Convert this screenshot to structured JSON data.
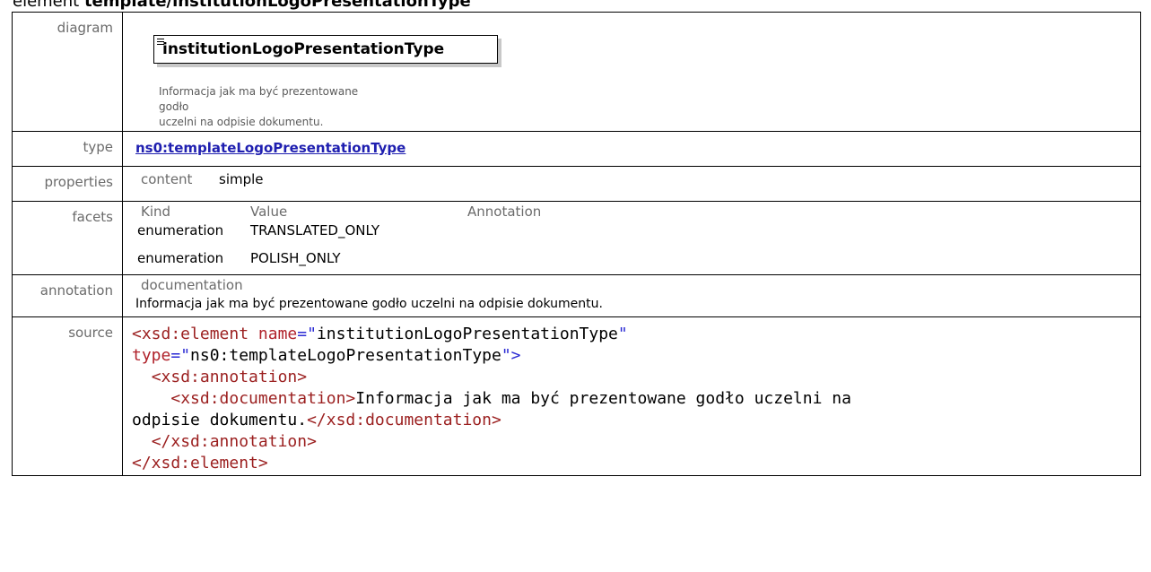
{
  "heading": {
    "prefix": "element ",
    "name": "template/institutionLogoPresentationType"
  },
  "labels": {
    "diagram": "diagram",
    "type": "type",
    "properties": "properties",
    "facets": "facets",
    "annotation": "annotation",
    "source": "source"
  },
  "diagram": {
    "element_name": "institutionLogoPresentationType",
    "doc_line1": "Informacja jak ma być prezentowane godło",
    "doc_line2": "uczelni na odpisie dokumentu."
  },
  "type": {
    "link": "ns0:templateLogoPresentationType"
  },
  "properties": {
    "key": "content",
    "value": "simple"
  },
  "facets": {
    "headers": [
      "Kind",
      "Value",
      "Annotation"
    ],
    "rows": [
      {
        "kind": "enumeration",
        "value": "TRANSLATED_ONLY"
      },
      {
        "kind": "enumeration",
        "value": "POLISH_ONLY"
      }
    ]
  },
  "annotation": {
    "key": "documentation",
    "value": "Informacja jak ma być prezentowane godło uczelni na odpisie dokumentu."
  },
  "source": {
    "l1_open": "<xsd:element",
    "l1_attr": "name",
    "l1_eq": "=\"",
    "l1_val": "institutionLogoPresentationType",
    "l1_q": "\"",
    "l2_attr": "type",
    "l2_eq": "=\"",
    "l2_val": "ns0:templateLogoPresentationType",
    "l2_close": "\">",
    "l3": "<xsd:annotation>",
    "l4_open": "<xsd:documentation>",
    "l4_text": "Informacja jak ma być prezentowane godło uczelni na",
    "l5_text": "odpisie dokumentu.",
    "l5_close": "</xsd:documentation>",
    "l6": "</xsd:annotation>",
    "l7": "</xsd:element>"
  }
}
